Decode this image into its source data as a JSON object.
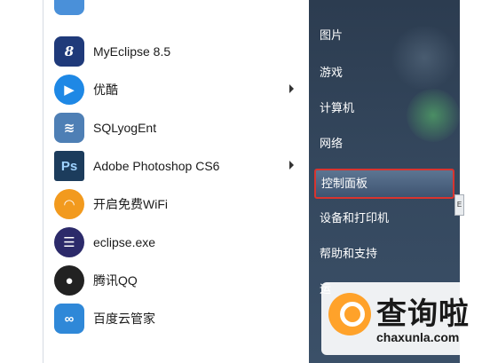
{
  "start_menu": {
    "programs": [
      {
        "label": "",
        "icon": "partial-top-icon",
        "color": "#4a90d9"
      },
      {
        "label": "MyEclipse 8.5",
        "icon": "myeclipse-icon",
        "color": "#1f3a7a"
      },
      {
        "label": "优酷",
        "icon": "youku-play-icon",
        "color": "#1e88e5",
        "submenu": true
      },
      {
        "label": "SQLyogEnt",
        "icon": "dolphin-icon",
        "color": "#4e7fb5"
      },
      {
        "label": "Adobe Photoshop CS6",
        "icon": "photoshop-icon",
        "color": "#1c3c5c",
        "submenu": true
      },
      {
        "label": "开启免费WiFi",
        "icon": "wifi-icon",
        "color": "#f29a1e"
      },
      {
        "label": "eclipse.exe",
        "icon": "eclipse-icon",
        "color": "#2c2a6a"
      },
      {
        "label": "腾讯QQ",
        "icon": "qq-penguin-icon",
        "color": "#222222"
      },
      {
        "label": "百度云管家",
        "icon": "baidu-cloud-icon",
        "color": "#2f88d8"
      }
    ],
    "right_items": [
      {
        "label": "图片"
      },
      {
        "label": "游戏"
      },
      {
        "label": "计算机"
      },
      {
        "label": "网络"
      },
      {
        "label": "控制面板",
        "highlighted": true
      },
      {
        "label": "设备和打印机"
      },
      {
        "label": "帮助和支持"
      },
      {
        "label": "运"
      }
    ],
    "side_tab_label": "E"
  },
  "watermark": {
    "title": "查询啦",
    "url": "chaxunla.com",
    "accent": "#ffa22a"
  }
}
